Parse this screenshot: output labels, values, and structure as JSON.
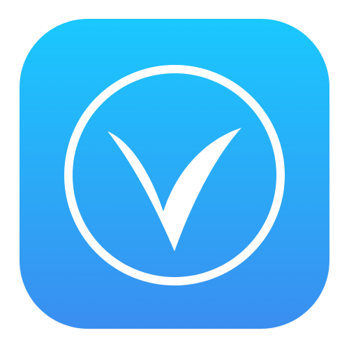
{
  "icon": {
    "name": "v-check-logo-icon",
    "colors": {
      "gradient_top": "#1ac8fe",
      "gradient_bottom": "#3a8ef0",
      "symbol": "#ffffff",
      "page_background": "#ffffff"
    }
  }
}
